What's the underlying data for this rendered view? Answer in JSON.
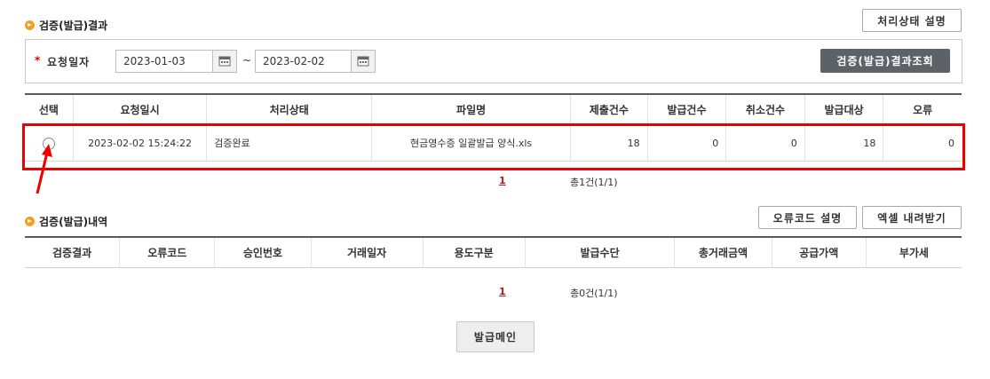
{
  "section1": {
    "title": "검증(발급)결과",
    "status_help_label": "처리상태 설명"
  },
  "search": {
    "required_mark": "*",
    "label": "요청일자",
    "start_date": "2023-01-03",
    "separator": "~",
    "end_date": "2023-02-02",
    "search_button": "검증(발급)결과조회"
  },
  "result_table": {
    "columns": [
      "선택",
      "요청일시",
      "처리상태",
      "파일명",
      "제출건수",
      "발급건수",
      "취소건수",
      "발급대상",
      "오류"
    ],
    "row": {
      "requested_at": "2023-02-02 15:24:22",
      "status": "검증완료",
      "file_name": "현금영수증 일괄발급 양식.xls",
      "submitted": "18",
      "issued": "0",
      "cancelled": "0",
      "target": "18",
      "errors": "0"
    }
  },
  "pager1": {
    "page": "1",
    "summary": "총1건(1/1)"
  },
  "section2": {
    "title": "검증(발급)내역",
    "error_code_help_label": "오류코드 설명",
    "excel_download_label": "엑셀 내려받기"
  },
  "detail_table": {
    "columns": [
      "검증결과",
      "오류코드",
      "승인번호",
      "거래일자",
      "용도구분",
      "발급수단",
      "총거래금액",
      "공급가액",
      "부가세"
    ]
  },
  "pager2": {
    "page": "1",
    "summary": "총0건(1/1)"
  },
  "footer": {
    "issue_main_label": "발급메인"
  },
  "colors": {
    "highlight": "#ee0000",
    "accent_bullet": "#f0a020",
    "dark_button": "#5d6168"
  }
}
